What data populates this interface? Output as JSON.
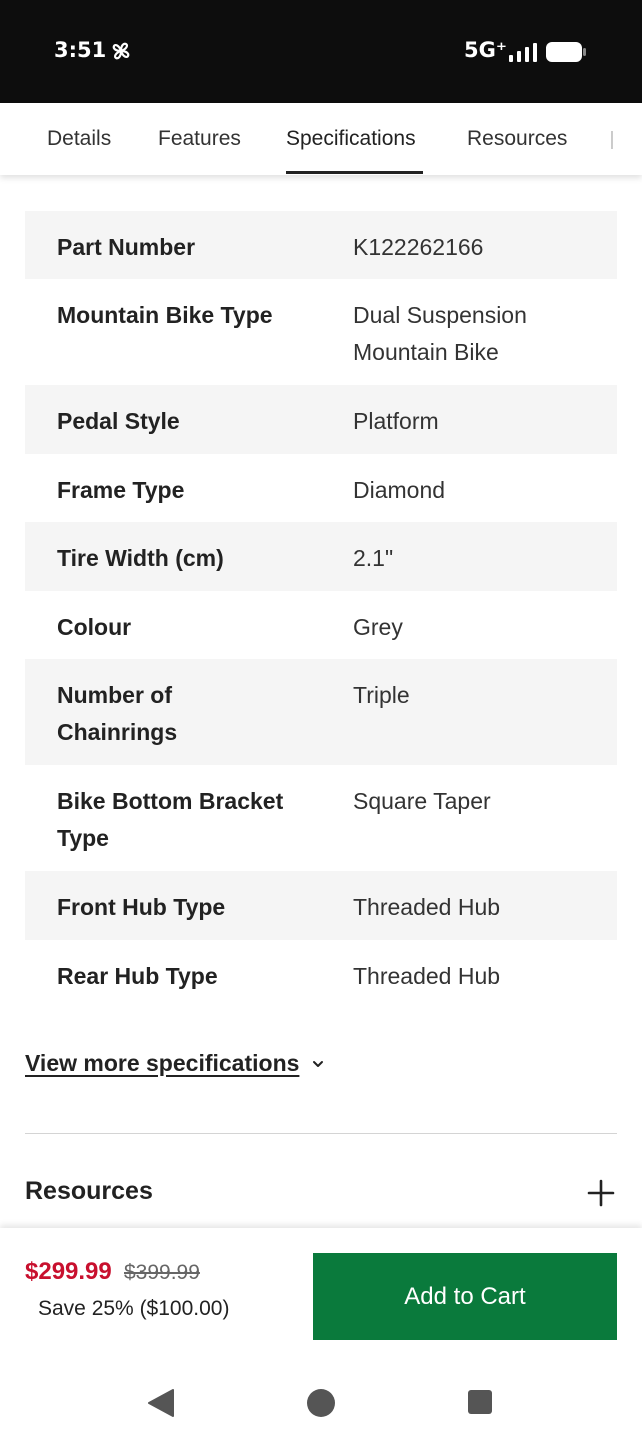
{
  "status_bar": {
    "time": "3:51",
    "network": "5G⁺"
  },
  "tabs": [
    {
      "label": "Details",
      "active": false
    },
    {
      "label": "Features",
      "active": false
    },
    {
      "label": "Specifications",
      "active": true
    },
    {
      "label": "Resources",
      "active": false
    }
  ],
  "specs": [
    {
      "label": "Part Number",
      "value": "K122262166"
    },
    {
      "label": "Mountain Bike Type",
      "value": "Dual Suspension Mountain Bike"
    },
    {
      "label": "Pedal Style",
      "value": "Platform"
    },
    {
      "label": "Frame Type",
      "value": "Diamond"
    },
    {
      "label": "Tire Width (cm)",
      "value": "2.1\""
    },
    {
      "label": "Colour",
      "value": "Grey"
    },
    {
      "label": "Number of Chainrings",
      "value": "Triple"
    },
    {
      "label": "Bike Bottom Bracket Type",
      "value": "Square Taper"
    },
    {
      "label": "Front Hub Type",
      "value": "Threaded Hub"
    },
    {
      "label": "Rear Hub Type",
      "value": "Threaded Hub"
    }
  ],
  "view_more": "View more specifications",
  "resources": {
    "title": "Resources"
  },
  "price_bar": {
    "price": "$299.99",
    "original_price": "$399.99",
    "savings": "Save 25% ($100.00)",
    "add_to_cart": "Add to Cart"
  },
  "colors": {
    "sale_price": "#c8102e",
    "add_to_cart": "#0a7a3c",
    "row_shade": "#f5f5f5"
  }
}
